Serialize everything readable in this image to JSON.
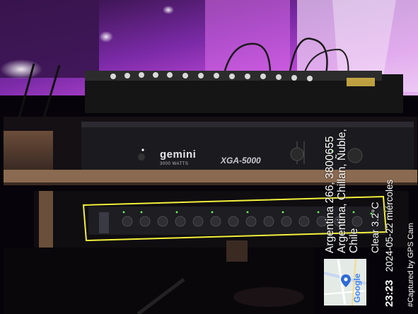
{
  "overlay": {
    "address_lines": [
      "Argentina 266, 3800655",
      "Argentina, Chillan, Ñuble,",
      "Chile"
    ],
    "weather": "Clear 3.2°C",
    "time": "23:23",
    "date": "2024-05-22 miércoles",
    "captured_by": "#Captured by GPS Cam",
    "map_label": "Google"
  },
  "equipment": {
    "amp_brand": "gemini",
    "amp_watts": "3000 WATTS",
    "amp_model": "XGA-5000"
  },
  "colors": {
    "highlight_box": "#f4f03a",
    "stage_purple": "#c23fe0",
    "led_green": "#6cff5a"
  }
}
